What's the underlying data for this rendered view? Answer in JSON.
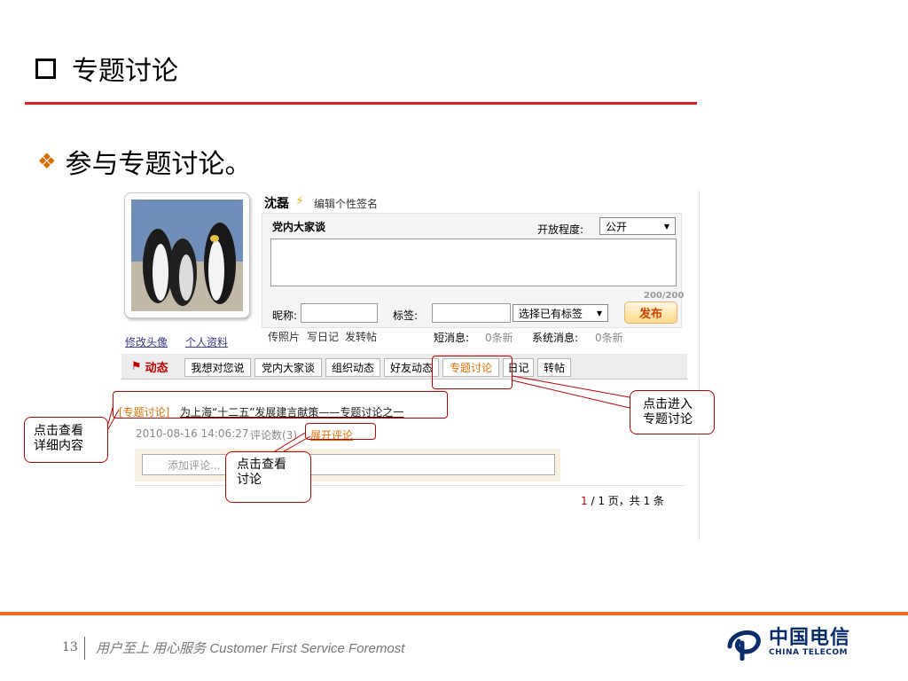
{
  "slide": {
    "title": "专题讨论",
    "bullet": "参与专题讨论。",
    "page_number": "13",
    "slogan": "用户至上 用心服务 Customer First Service Foremost",
    "logo_cn": "中国电信",
    "logo_en": "CHINA TELECOM"
  },
  "profile": {
    "name": "沈磊",
    "edit_signature": "编辑个性签名",
    "edit_avatar": "修改头像",
    "personal_info": "个人资料"
  },
  "post_panel": {
    "title": "党内大家谈",
    "openness_label": "开放程度:",
    "openness_value": "公开",
    "counter": "200/200",
    "nickname_label": "昵称:",
    "tag_label": "标签:",
    "tag_select": "选择已有标签",
    "publish": "发布"
  },
  "actions": {
    "upload_photo": "传照片",
    "write_diary": "写日记",
    "share_post": "发转帖",
    "short_msg_label": "短消息:",
    "short_msg_value": "0条新",
    "system_msg_label": "系统消息:",
    "system_msg_value": "0条新"
  },
  "tabs": [
    {
      "label": "动态"
    },
    {
      "label": "我想对您说"
    },
    {
      "label": "党内大家谈"
    },
    {
      "label": "组织动态"
    },
    {
      "label": "好友动态"
    },
    {
      "label": "专题讨论"
    },
    {
      "label": "日记"
    },
    {
      "label": "转帖"
    }
  ],
  "feed": {
    "category": "[专题讨论]",
    "title": "为上海“十二五”发展建言献策——专题讨论之一",
    "timestamp": "2010-08-16 14:06:27",
    "comment_count_label": "评论数(3)",
    "expand_comments": "展开评论",
    "comment_placeholder": "添加评论..."
  },
  "pagination": {
    "current": "1",
    "rest": "/ 1 页，共 1 条"
  },
  "callouts": {
    "enter_topic": "点击进入专题讨论",
    "view_detail": "点击查看详细内容",
    "view_discussion": "点击查看讨论"
  },
  "colors": {
    "accent_red": "#e02020",
    "footer_orange": "#e86d1c",
    "active_tab": "#e07000",
    "callout_border": "#c00000"
  }
}
